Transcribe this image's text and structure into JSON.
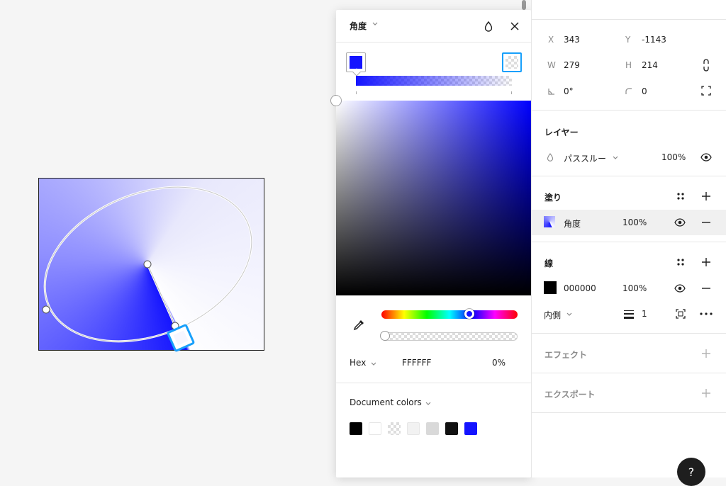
{
  "picker": {
    "mode_label": "角度",
    "hex_label": "Hex",
    "hex_value": "FFFFFF",
    "opacity_value": "0%",
    "document_colors_label": "Document colors",
    "stop_colors": [
      "#1414ff",
      "transparent"
    ],
    "hue_level": 0.66,
    "alpha_level": 0.0,
    "document_swatches": [
      "#000000",
      "#ffffff",
      "checker",
      "#f2f2f2",
      "#d9d9d9",
      "#111111",
      "#1414ff"
    ]
  },
  "canvas": {
    "fill_accent": "#1414ff",
    "selection_color": "#18a0fb"
  },
  "props": {
    "x_label": "X",
    "x_value": "343",
    "y_label": "Y",
    "y_value": "-1143",
    "w_label": "W",
    "w_value": "279",
    "h_label": "H",
    "h_value": "214",
    "rotation_value": "0°",
    "radius_value": "0",
    "layer_title": "レイヤー",
    "blend_mode": "パススルー",
    "layer_opacity": "100%",
    "fill_title": "塗り",
    "fill_type": "角度",
    "fill_opacity": "100%",
    "stroke_title": "線",
    "stroke_hex": "000000",
    "stroke_opacity": "100%",
    "stroke_position": "内側",
    "stroke_weight": "1",
    "effects_title": "エフェクト",
    "export_title": "エクスポート",
    "help_label": "?"
  },
  "icons": [
    "drop-icon",
    "close-icon",
    "eyedropper-icon",
    "chevron-down-icon",
    "link-icon",
    "expand-icon",
    "eye-icon",
    "plus-icon",
    "minus-icon",
    "styles-icon",
    "more-icon",
    "stroke-weight-icon",
    "stroke-sides-icon",
    "corner-radius-icon",
    "rotation-icon"
  ]
}
